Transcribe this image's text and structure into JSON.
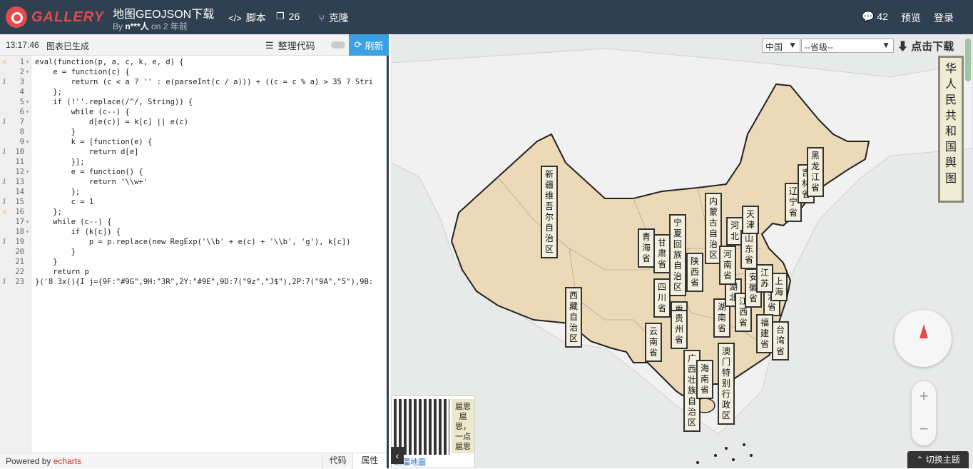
{
  "header": {
    "logo_text": "GALLERY",
    "title": "地图GEOJSON下载",
    "byline_prefix": "By",
    "author": "n***人",
    "byline_suffix": "on 2 年前",
    "nav": {
      "script": "脚本",
      "forks": "26",
      "clone": "克隆"
    },
    "comments": "42",
    "preview": "预览",
    "login": "登录"
  },
  "editor": {
    "time": "13:17:46",
    "status": "图表已生成",
    "format_label": "整理代码",
    "refresh_label": "刷新",
    "lines": [
      {
        "n": "1",
        "mark": "warn",
        "fold": true,
        "code": "eval(function(p, a, c, k, e, d) {"
      },
      {
        "n": "2",
        "mark": "",
        "fold": true,
        "code": "    e = function(c) {"
      },
      {
        "n": "3",
        "mark": "info",
        "fold": false,
        "code": "        return (c < a ? '' : e(parseInt(c / a))) + ((c = c % a) > 35 ? Stri"
      },
      {
        "n": "4",
        "mark": "",
        "fold": false,
        "code": "    };"
      },
      {
        "n": "5",
        "mark": "",
        "fold": true,
        "code": "    if (!''.replace(/^/, String)) {"
      },
      {
        "n": "6",
        "mark": "",
        "fold": true,
        "code": "        while (c--) {"
      },
      {
        "n": "7",
        "mark": "info",
        "fold": false,
        "code": "            d[e(c)] = k[c] || e(c)"
      },
      {
        "n": "8",
        "mark": "",
        "fold": false,
        "code": "        }"
      },
      {
        "n": "9",
        "mark": "",
        "fold": true,
        "code": "        k = [function(e) {"
      },
      {
        "n": "10",
        "mark": "info",
        "fold": false,
        "code": "            return d[e]"
      },
      {
        "n": "11",
        "mark": "",
        "fold": false,
        "code": "        }];"
      },
      {
        "n": "12",
        "mark": "",
        "fold": true,
        "code": "        e = function() {"
      },
      {
        "n": "13",
        "mark": "info",
        "fold": false,
        "code": "            return '\\\\w+'"
      },
      {
        "n": "14",
        "mark": "",
        "fold": false,
        "code": "        };"
      },
      {
        "n": "15",
        "mark": "info",
        "fold": false,
        "code": "        c = 1"
      },
      {
        "n": "16",
        "mark": "warn",
        "fold": false,
        "code": "    };"
      },
      {
        "n": "17",
        "mark": "",
        "fold": true,
        "code": "    while (c--) {"
      },
      {
        "n": "18",
        "mark": "",
        "fold": true,
        "code": "        if (k[c]) {"
      },
      {
        "n": "19",
        "mark": "info",
        "fold": false,
        "code": "            p = p.replace(new RegExp('\\\\b' + e(c) + '\\\\b', 'g'), k[c])"
      },
      {
        "n": "20",
        "mark": "",
        "fold": false,
        "code": "        }"
      },
      {
        "n": "21",
        "mark": "",
        "fold": false,
        "code": "    }"
      },
      {
        "n": "22",
        "mark": "",
        "fold": false,
        "code": "    return p"
      },
      {
        "n": "23",
        "mark": "info",
        "fold": false,
        "code": "}('8 3x(){I j={9F:\"#9G\",9H:\"3R\",2Y:\"#9E\",9D:7(\"9z\",\"J$\"),2P:7(\"9A\",\"5\"),9B:"
      }
    ],
    "powered_prefix": "Powered by",
    "powered_link": "echarts",
    "tab_code": "代码",
    "tab_attr": "属性"
  },
  "map": {
    "country_select": "中国",
    "province_select": "--省级--",
    "download_label": "点击下载",
    "banner": [
      "华",
      "人",
      "民",
      "共",
      "和",
      "国",
      "舆",
      "图"
    ],
    "labels": [
      {
        "name": "新疆维吾尔自治区",
        "chars": [
          "新",
          "疆",
          "维",
          "吾",
          "尔",
          "自",
          "治",
          "区"
        ]
      },
      {
        "name": "西藏自治区",
        "chars": [
          "西",
          "藏",
          "自",
          "治",
          "区"
        ]
      },
      {
        "name": "青海省",
        "chars": [
          "青",
          "海",
          "省"
        ]
      },
      {
        "name": "甘肃省",
        "chars": [
          "甘",
          "肃",
          "省"
        ]
      },
      {
        "name": "宁夏回族自治区",
        "chars": [
          "宁",
          "夏",
          "回",
          "族",
          "自",
          "治",
          "区"
        ]
      },
      {
        "name": "内蒙古自治区",
        "chars": [
          "内",
          "蒙",
          "古",
          "自",
          "治",
          "区"
        ]
      },
      {
        "name": "陕西省",
        "chars": [
          "陕",
          "西",
          "省"
        ]
      },
      {
        "name": "四川省",
        "chars": [
          "四",
          "川",
          "省"
        ]
      },
      {
        "name": "重庆",
        "chars": [
          "重",
          "庆"
        ]
      },
      {
        "name": "贵州省",
        "chars": [
          "贵",
          "州",
          "省"
        ]
      },
      {
        "name": "云南省",
        "chars": [
          "云",
          "南",
          "省"
        ]
      },
      {
        "name": "广西壮族自治区",
        "chars": [
          "广",
          "西",
          "壮",
          "族",
          "自",
          "治",
          "区"
        ]
      },
      {
        "name": "海南省",
        "chars": [
          "海",
          "南",
          "省"
        ]
      },
      {
        "name": "澳门特别行政区",
        "chars": [
          "澳",
          "门",
          "特",
          "别",
          "行",
          "政",
          "区"
        ]
      },
      {
        "name": "湖南省",
        "chars": [
          "湖",
          "南",
          "省"
        ]
      },
      {
        "name": "湖北",
        "chars": [
          "湖",
          "北"
        ]
      },
      {
        "name": "江西省",
        "chars": [
          "江",
          "西",
          "省"
        ]
      },
      {
        "name": "河南省",
        "chars": [
          "河",
          "南",
          "省"
        ]
      },
      {
        "name": "河北",
        "chars": [
          "河",
          "北"
        ]
      },
      {
        "name": "山东省",
        "chars": [
          "山",
          "东",
          "省"
        ]
      },
      {
        "name": "天津",
        "chars": [
          "天",
          "津"
        ]
      },
      {
        "name": "安徽省",
        "chars": [
          "安",
          "徽",
          "省"
        ]
      },
      {
        "name": "浙江省",
        "chars": [
          "浙",
          "江",
          "省"
        ]
      },
      {
        "name": "上海",
        "chars": [
          "上",
          "海"
        ]
      },
      {
        "name": "福建省",
        "chars": [
          "福",
          "建",
          "省"
        ]
      },
      {
        "name": "台湾省",
        "chars": [
          "台",
          "湾",
          "省"
        ]
      },
      {
        "name": "辽宁省",
        "chars": [
          "辽",
          "宁",
          "省"
        ]
      },
      {
        "name": "吉林省",
        "chars": [
          "吉",
          "林",
          "省"
        ]
      },
      {
        "name": "黑龙江省",
        "chars": [
          "黑",
          "龙",
          "江",
          "省"
        ]
      },
      {
        "name": "江苏",
        "chars": [
          "江",
          "苏"
        ]
      }
    ],
    "qr_text": "扈思扈思，一点扈思",
    "qr_caption": "扈僵地圖",
    "theme_button": "切换主题",
    "colors": {
      "land": "#ecd9b8",
      "sea": "#e8eaea",
      "border": "#222222",
      "accent": "#e14b50"
    }
  }
}
